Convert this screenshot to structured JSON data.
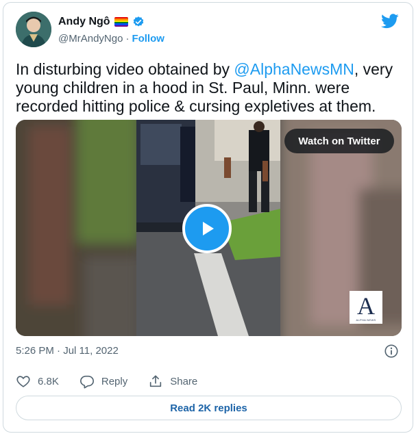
{
  "author": {
    "display_name": "Andy Ngô",
    "handle": "@MrAndyNgo",
    "separator": "·",
    "follow_label": "Follow"
  },
  "tweet": {
    "text_before": "In disturbing video obtained by ",
    "mention": "@AlphaNewsMN",
    "text_after": ", very young children in a hood in St. Paul, Minn. were recorded hitting police & cursing expletives at them."
  },
  "media": {
    "watch_label": "Watch on Twitter",
    "logo_letter": "A",
    "logo_text": "ALPHA NEWS"
  },
  "meta": {
    "timestamp": "5:26 PM · Jul 11, 2022"
  },
  "actions": {
    "likes": "6.8K",
    "reply_label": "Reply",
    "share_label": "Share"
  },
  "read_replies_label": "Read 2K replies",
  "colors": {
    "twitter_blue": "#1d9bf0",
    "text_primary": "#0f1419",
    "text_secondary": "#536471",
    "border": "#cfd9de"
  },
  "icons": [
    "twitter-bird-icon",
    "verified-badge-icon",
    "rainbow-flag-icon",
    "play-icon",
    "info-icon",
    "heart-icon",
    "reply-icon",
    "share-icon"
  ]
}
